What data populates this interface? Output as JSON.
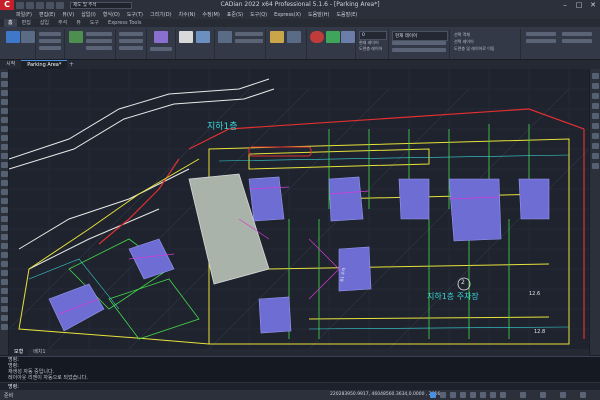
{
  "window": {
    "title": "CADian 2022 x64 Professional 5.1.6 - [Parking Area*]",
    "minimize_glyph": "–",
    "maximize_glyph": "□",
    "close_glyph": "✕",
    "logo_letter": "C"
  },
  "search": {
    "value": "제도 및 주석"
  },
  "menu": [
    "파일(F)",
    "편집(E)",
    "뷰(V)",
    "삽입(I)",
    "형식(O)",
    "도구(T)",
    "그리기(D)",
    "치수(N)",
    "수정(M)",
    "표준(S)",
    "도구(Q)",
    "Express(X)",
    "도움말(H)",
    "도움말(E)"
  ],
  "ribbon_tabs": [
    {
      "label": "홈",
      "active": true
    },
    {
      "label": "편집",
      "active": false
    },
    {
      "label": "삽입",
      "active": false
    },
    {
      "label": "주석",
      "active": false
    },
    {
      "label": "뷰",
      "active": false
    },
    {
      "label": "도구",
      "active": false
    },
    {
      "label": "Express Tools",
      "active": false
    }
  ],
  "ribbon": {
    "layer_current": "0",
    "layer_items": [
      "현재 레이어",
      "도면층 레이어",
      "현재 레이어"
    ],
    "right_items": [
      "선택 객체",
      "선택 레이어",
      "도면층 및 레이어로 이동"
    ]
  },
  "doc_tabs": [
    {
      "label": "시작",
      "active": false
    },
    {
      "label": "Parking Area*",
      "active": true
    }
  ],
  "drawing": {
    "label_b1": "지하1층",
    "label_b1_parking": "지하1층 주차장",
    "label_b1_parking_short": "B1 주차",
    "label_circle": "2",
    "label_dim_1": "12.6",
    "label_dim_2": "12.8"
  },
  "layout_tabs": [
    {
      "label": "모형",
      "active": true
    },
    {
      "label": "배치1",
      "active": false
    }
  ],
  "command": {
    "history": [
      "명령:",
      "명령:",
      "재생성 자동 중입니다.",
      "레이아웃 리젠이 자동으로 되었습니다."
    ],
    "prompt": "명령:"
  },
  "status": {
    "app_short": "준비",
    "coords": "220283950.9917, 46048560.3634,0.0000 , 2016"
  },
  "colors": {
    "accent": "#4a8fe0",
    "yellow": "#e8e23a",
    "magenta": "#d63cd9",
    "red": "#e03030",
    "cyan": "#3ad6d6",
    "green": "#44d94a",
    "white": "#e8e8e8"
  }
}
